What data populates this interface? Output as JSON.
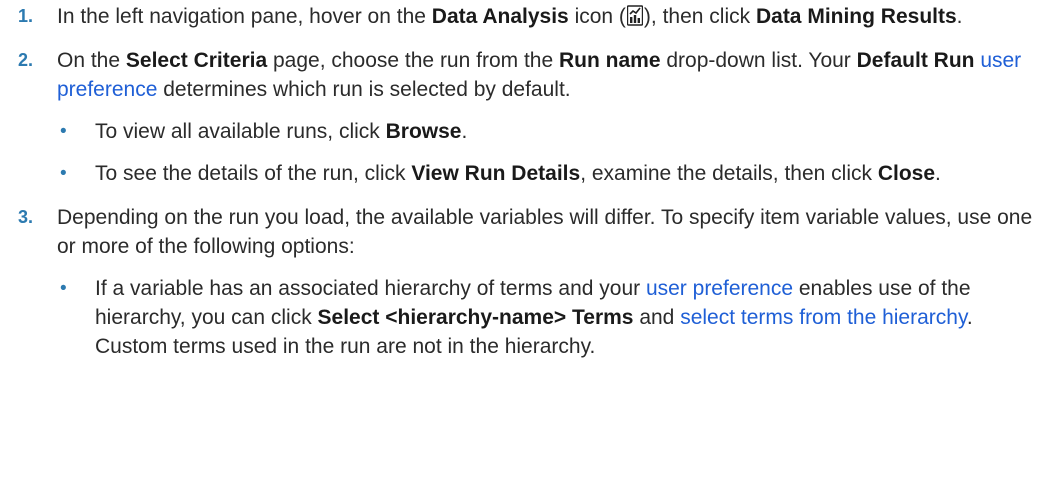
{
  "icon_name": "data-analysis-icon",
  "steps": [
    {
      "num": "1.",
      "t1": "In the left navigation pane, hover on the ",
      "b1": "Data Analysis",
      "t2": " icon (",
      "t3": "), then click ",
      "b2": "Data Mining Results",
      "t4": "."
    },
    {
      "num": "2.",
      "t1": "On the ",
      "b1": "Select Criteria",
      "t2": " page, choose the run from the ",
      "b2": "Run name",
      "t3": " drop-down list. Your ",
      "b3": "Default Run",
      "t4": " ",
      "link1": "user preference",
      "t5": " determines which run is selected by default.",
      "bullets": [
        {
          "bullet": "•",
          "t1": "To view all available runs, click ",
          "b1": "Browse",
          "t2": "."
        },
        {
          "bullet": "•",
          "t1": "To see the details of the run, click ",
          "b1": "View Run Details",
          "t2": ", examine the details, then click ",
          "b2": "Close",
          "t3": "."
        }
      ]
    },
    {
      "num": "3.",
      "t1": "Depending on the run you load, the available variables will differ. To specify item variable values, use one or more of the following options:",
      "bullets": [
        {
          "bullet": "•",
          "t1": "If a variable has an associated hierarchy of terms and your ",
          "link1": "user preference",
          "t2": " enables use of the hierarchy, you can click ",
          "b1": "Select <hierarchy-name> Terms",
          "t3": " and ",
          "link2": "select terms from the hierarchy",
          "t4": ". Custom terms used in the run are not in the hierarchy."
        }
      ]
    }
  ]
}
